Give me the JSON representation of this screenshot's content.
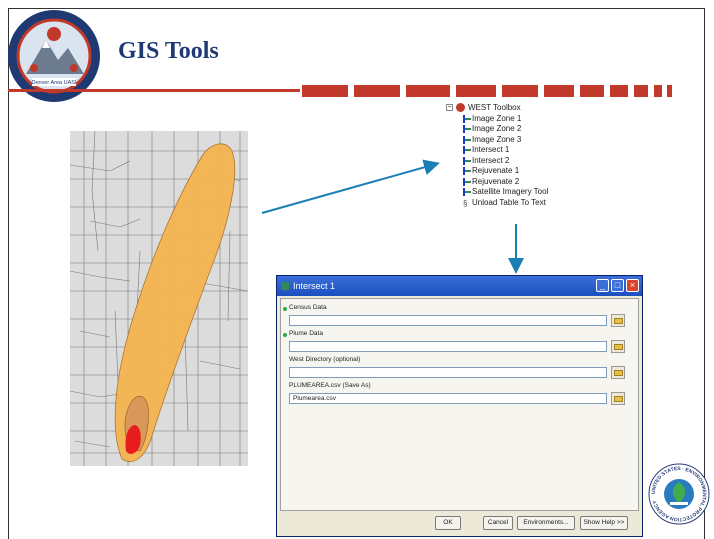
{
  "header": {
    "title": "GIS Tools",
    "logo_text": "Denver Area UASI"
  },
  "toolbox": {
    "root_label": "WEST Toolbox",
    "items": [
      "Image Zone 1",
      "Image Zone 2",
      "Image Zone 3",
      "Intersect 1",
      "Intersect 2",
      "Rejuvenate 1",
      "Rejuvenate 2",
      "Satellite Imagery Tool"
    ],
    "script_item": "Unload Table To Text"
  },
  "dialog": {
    "title": "Intersect 1",
    "fields": [
      {
        "label": "Census Data",
        "value": "",
        "required": true
      },
      {
        "label": "Plume Data",
        "value": "",
        "required": true
      },
      {
        "label": "West Directory (optional)",
        "value": "",
        "required": false
      },
      {
        "label": "PLUMEAREA.csv (Save As)",
        "value": "Plumearea.csv",
        "required": false
      }
    ],
    "buttons": {
      "ok": "OK",
      "cancel": "Cancel",
      "environments": "Environments...",
      "help": "Show Help >>"
    }
  },
  "epa_seal": {
    "text": "UNITED STATES · ENVIRONMENTAL PROTECTION AGENCY"
  },
  "colors": {
    "title": "#1f3a73",
    "accent_red": "#c0392b",
    "plume_outer": "#f5b450",
    "plume_inner": "#d9975a",
    "plume_core": "#e81c1c",
    "arrow": "#1b7fb5"
  }
}
